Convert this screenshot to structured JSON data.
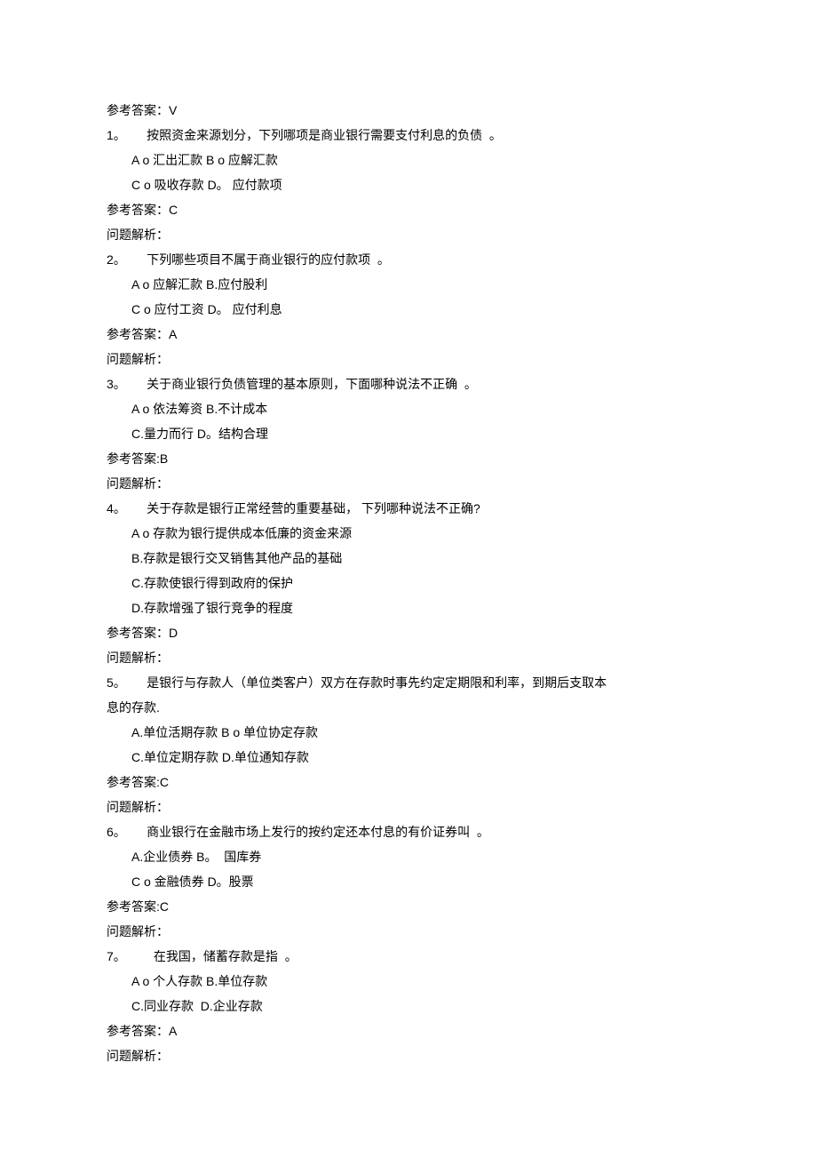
{
  "pre_answer": "参考答案：V",
  "questions": [
    {
      "num": "1",
      "sep": "。",
      "stem": "按照资金来源划分，下列哪项是商业银行需要支付利息的负债  。",
      "option_lines": [
        "A o 汇出汇款 B o 应解汇款",
        "C o 吸收存款 D。 应付款项"
      ],
      "answer": "参考答案：C",
      "analysis": "问题解析："
    },
    {
      "num": "2",
      "sep": "。",
      "stem": "下列哪些项目不属于商业银行的应付款项  。",
      "option_lines": [
        "A o 应解汇款 B.应付股利",
        "C o 应付工资 D。 应付利息"
      ],
      "answer": "参考答案：A",
      "analysis": "问题解析："
    },
    {
      "num": "3",
      "sep": "。",
      "stem": "关于商业银行负债管理的基本原则，下面哪种说法不正确  。",
      "option_lines": [
        "A o 依法筹资 B.不计成本",
        "C.量力而行 D。结构合理"
      ],
      "answer": "参考答案:B",
      "analysis": "问题解析："
    },
    {
      "num": "4",
      "sep": "。",
      "stem": "关于存款是银行正常经营的重要基础， 下列哪种说法不正确?",
      "option_lines": [
        "A o 存款为银行提供成本低廉的资金来源",
        "B.存款是银行交叉销售其他产品的基础",
        "C.存款使银行得到政府的保护",
        "D.存款增强了银行竞争的程度"
      ],
      "answer": "参考答案：D",
      "analysis": "问题解析："
    },
    {
      "num": "5",
      "sep": "。",
      "stem": "是银行与存款人（单位类客户）双方在存款时事先约定定期限和利率，到期后支取本",
      "stem_cont": "息的存款.",
      "option_lines": [
        "A.单位活期存款 B o 单位协定存款",
        "C.单位定期存款 D.单位通知存款"
      ],
      "answer": "参考答案:C",
      "analysis": "问题解析："
    },
    {
      "num": "6",
      "sep": "。",
      "stem": "商业银行在金融市场上发行的按约定还本付息的有价证券叫  。",
      "option_lines": [
        "A.企业债券 B。  国库券",
        "C o 金融债券 D。股票"
      ],
      "answer": "参考答案:C",
      "analysis": "问题解析："
    },
    {
      "num": "7",
      "sep": "。",
      "stem": "在我国，储蓄存款是指  。",
      "option_lines": [
        "A o 个人存款 B.单位存款",
        "C.同业存款  D.企业存款"
      ],
      "answer": "参考答案：A",
      "analysis": "问题解析："
    }
  ]
}
